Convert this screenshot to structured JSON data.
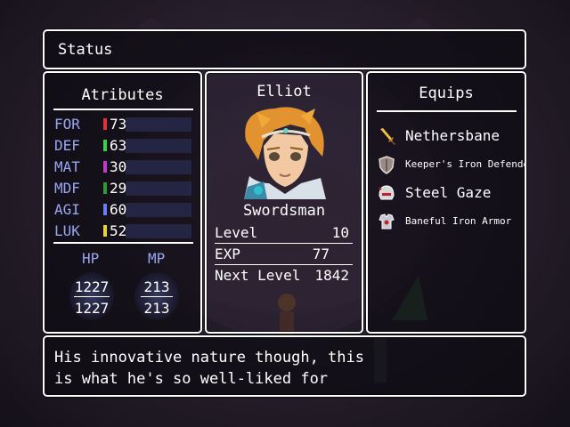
{
  "screen": {
    "title": "Status"
  },
  "attributes": {
    "header": "Atributes",
    "stats": [
      {
        "name": "FOR",
        "value": "73",
        "color": "#e0343c"
      },
      {
        "name": "DEF",
        "value": "63",
        "color": "#3ad04a"
      },
      {
        "name": "MAT",
        "value": "30",
        "color": "#c03ad0"
      },
      {
        "name": "MDF",
        "value": "29",
        "color": "#2f9a3a"
      },
      {
        "name": "AGI",
        "value": "60",
        "color": "#6d7cf0"
      },
      {
        "name": "LUK",
        "value": "52",
        "color": "#e8d23a"
      }
    ],
    "hp_label": "HP",
    "mp_label": "MP",
    "hp_current": "1227",
    "hp_max": "1227",
    "mp_current": "213",
    "mp_max": "213"
  },
  "character": {
    "name": "Elliot",
    "class": "Swordsman",
    "level_label": "Level",
    "level": "10",
    "exp_label": "EXP",
    "exp": "77",
    "next_level_label": "Next Level",
    "next_level": "1842"
  },
  "equips": {
    "header": "Equips",
    "items": [
      {
        "name": "Nethersbane",
        "icon": "sword-icon"
      },
      {
        "name": "Keeper's Iron Defender",
        "icon": "shield-icon"
      },
      {
        "name": "Steel Gaze",
        "icon": "helmet-icon"
      },
      {
        "name": "Baneful Iron Armor",
        "icon": "armor-icon"
      }
    ]
  },
  "message": {
    "line1": "His innovative nature though, this",
    "line2": "is what he's so well-liked for"
  }
}
